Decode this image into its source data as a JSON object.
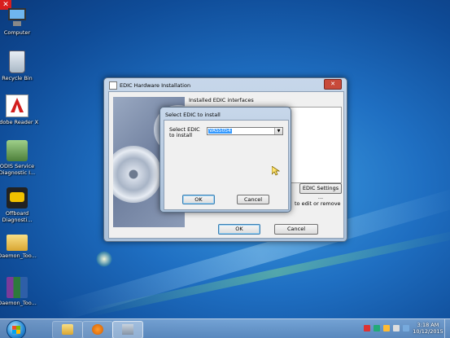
{
  "desktop": {
    "icons": [
      {
        "label": "Computer",
        "icon": "computer-icon"
      },
      {
        "label": "Recycle Bin",
        "icon": "recycle-bin-icon"
      },
      {
        "label": "Adobe Reader X",
        "icon": "adobe-reader-icon"
      },
      {
        "label": "ODIS Service Diagnostic I...",
        "icon": "odis-icon"
      },
      {
        "label": "Offboard Diagnosti...",
        "icon": "obd-icon"
      },
      {
        "label": "Daemon_Too...",
        "icon": "folder-icon"
      },
      {
        "label": "Daemon_Too...",
        "icon": "winrar-icon"
      }
    ]
  },
  "hw_window": {
    "title": "EDIC Hardware Installation",
    "close": "✕",
    "installed_label": "Installed EDIC interfaces",
    "edic_settings_btn": "EDIC Settings ...",
    "hint_text": "to edit or remove",
    "ok": "OK",
    "cancel": "Cancel"
  },
  "select_dialog": {
    "title": "Select EDIC to install",
    "label": "Select EDIC to install",
    "selected_value": "VAS5054",
    "ok": "OK",
    "cancel": "Cancel"
  },
  "taskbar": {
    "time": "3:18 AM",
    "date": "10/12/2015",
    "colors": {
      "accent": "#1f6fc2"
    }
  }
}
